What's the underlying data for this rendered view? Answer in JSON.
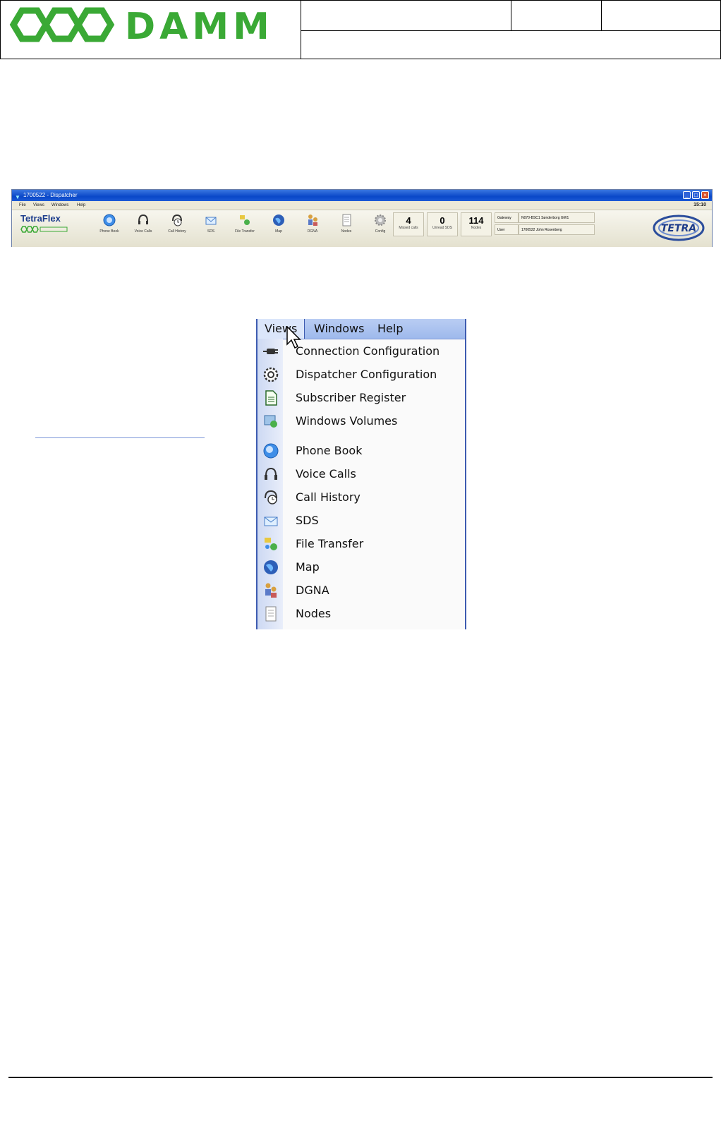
{
  "header": {
    "logo_text": "DAMM",
    "brand_color": "#3aa935"
  },
  "dispatcher_window": {
    "title": "1700522 - Dispatcher",
    "menu": [
      "File",
      "Views",
      "Windows",
      "Help"
    ],
    "clock": "15:10",
    "brand": "TetraFlex",
    "toolbar": [
      "Phone Book",
      "Voice Calls",
      "Call History",
      "SDS",
      "File Transfer",
      "Map",
      "DGNA",
      "Nodes",
      "Config"
    ],
    "counters": [
      {
        "value": "4",
        "label": "Missed calls"
      },
      {
        "value": "0",
        "label": "Unread SDS"
      },
      {
        "value": "114",
        "label": "Nodes"
      }
    ],
    "gateway_label": "Gateway",
    "gateway_value": "N070-BSC1 Sønderborg GW1",
    "user_label": "User",
    "user_value": "1700522 John Rosenberg",
    "tetra_logo": "TETRA"
  },
  "views_menu": {
    "menubar": [
      "Views",
      "Windows",
      "Help"
    ],
    "items": [
      {
        "label": "Connection Configuration",
        "icon": "plug-icon"
      },
      {
        "label": "Dispatcher Configuration",
        "icon": "gear-icon"
      },
      {
        "label": "Subscriber Register",
        "icon": "document-icon"
      },
      {
        "label": "Windows Volumes",
        "icon": "volume-icon"
      },
      {
        "label": "Phone Book",
        "icon": "phone-book-icon"
      },
      {
        "label": "Voice Calls",
        "icon": "headset-icon"
      },
      {
        "label": "Call History",
        "icon": "call-history-icon"
      },
      {
        "label": "SDS",
        "icon": "sds-icon"
      },
      {
        "label": "File Transfer",
        "icon": "file-transfer-icon"
      },
      {
        "label": "Map",
        "icon": "globe-icon"
      },
      {
        "label": "DGNA",
        "icon": "dgna-icon"
      },
      {
        "label": "Nodes",
        "icon": "nodes-icon"
      }
    ]
  }
}
